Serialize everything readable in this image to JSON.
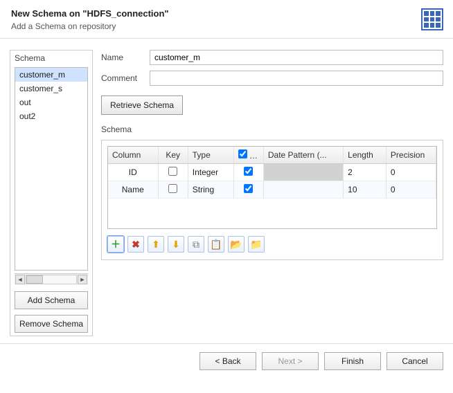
{
  "header": {
    "title": "New Schema on \"HDFS_connection\"",
    "subtitle": "Add a Schema on repository"
  },
  "left": {
    "title": "Schema",
    "items": [
      "customer_m",
      "customer_s",
      "out",
      "out2"
    ],
    "selected_index": 0,
    "add_label": "Add Schema",
    "remove_label": "Remove Schema"
  },
  "form": {
    "name_label": "Name",
    "name_value": "customer_m",
    "comment_label": "Comment",
    "comment_value": "",
    "retrieve_label": "Retrieve Schema"
  },
  "schema_section": {
    "title": "Schema",
    "columns": {
      "column": "Column",
      "key": "Key",
      "type": "Type",
      "nullable_header_checked": true,
      "nullable": "N..",
      "date_pattern": "Date Pattern (...",
      "length": "Length",
      "precision": "Precision"
    },
    "rows": [
      {
        "column": "ID",
        "key": false,
        "type": "Integer",
        "nullable": true,
        "date_pattern_shaded": true,
        "length": "2",
        "precision": "0"
      },
      {
        "column": "Name",
        "key": false,
        "type": "String",
        "nullable": true,
        "date_pattern_shaded": false,
        "length": "10",
        "precision": "0"
      }
    ]
  },
  "footer": {
    "back": "< Back",
    "next": "Next >",
    "finish": "Finish",
    "cancel": "Cancel"
  }
}
